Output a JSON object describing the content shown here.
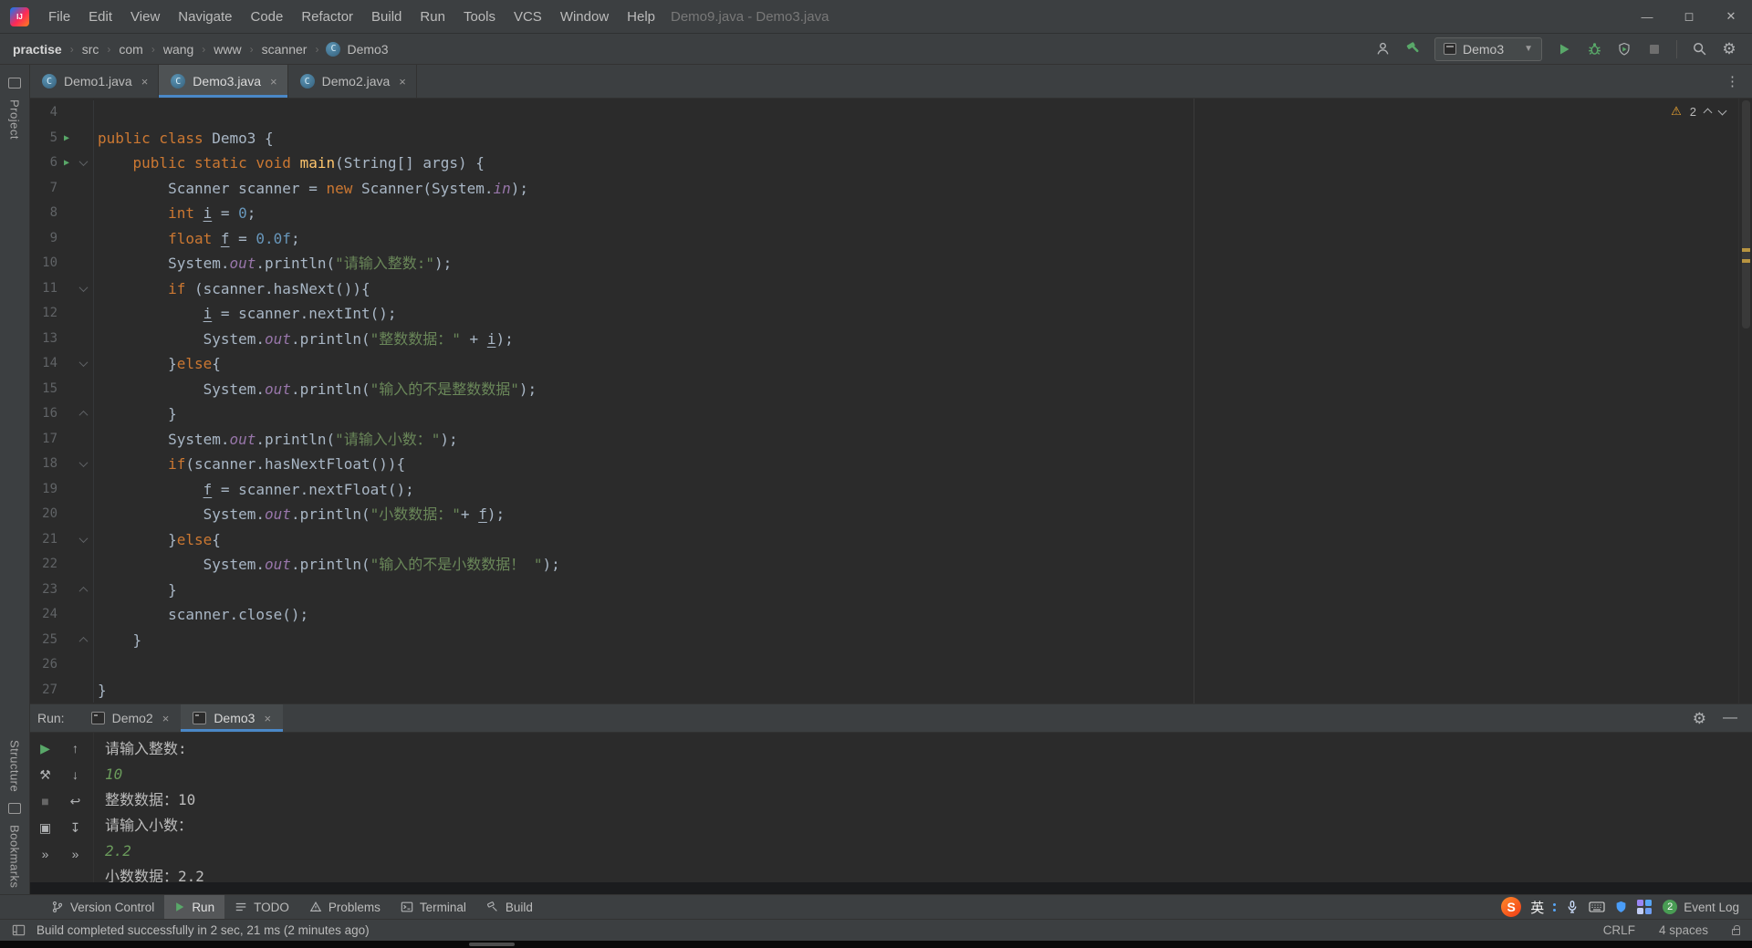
{
  "title_bar": {
    "logo": "IJ",
    "menus": [
      "File",
      "Edit",
      "View",
      "Navigate",
      "Code",
      "Refactor",
      "Build",
      "Run",
      "Tools",
      "VCS",
      "Window",
      "Help"
    ],
    "window_title": "Demo9.java - Demo3.java"
  },
  "nav_bar": {
    "breadcrumb": [
      "practise",
      "src",
      "com",
      "wang",
      "www",
      "scanner",
      "Demo3"
    ],
    "run_config": "Demo3"
  },
  "editor_tabs": [
    {
      "label": "Demo1.java",
      "active": false
    },
    {
      "label": "Demo3.java",
      "active": true
    },
    {
      "label": "Demo2.java",
      "active": false
    }
  ],
  "left_stripe": {
    "top": "Project",
    "bottom": [
      "Structure",
      "Bookmarks"
    ]
  },
  "inspection": {
    "warning_count": "2"
  },
  "editor": {
    "lines": [
      {
        "n": "4",
        "segs": []
      },
      {
        "n": "5",
        "run": true,
        "segs": [
          [
            "k",
            "public class "
          ],
          [
            "p",
            "Demo3 {"
          ]
        ]
      },
      {
        "n": "6",
        "run": true,
        "fold": "down",
        "segs": [
          [
            "p",
            "    "
          ],
          [
            "k",
            "public static void "
          ],
          [
            "m",
            "main"
          ],
          [
            "p",
            "(String[] args) {"
          ]
        ]
      },
      {
        "n": "7",
        "segs": [
          [
            "p",
            "        Scanner scanner = "
          ],
          [
            "k",
            "new "
          ],
          [
            "p",
            "Scanner(System."
          ],
          [
            "f",
            "in"
          ],
          [
            "p",
            ");"
          ]
        ]
      },
      {
        "n": "8",
        "segs": [
          [
            "p",
            "        "
          ],
          [
            "k",
            "int "
          ],
          [
            "u",
            "i"
          ],
          [
            "p",
            " = "
          ],
          [
            "n2",
            "0"
          ],
          [
            "p",
            ";"
          ]
        ]
      },
      {
        "n": "9",
        "segs": [
          [
            "p",
            "        "
          ],
          [
            "k",
            "float "
          ],
          [
            "u",
            "f"
          ],
          [
            "p",
            " = "
          ],
          [
            "n2",
            "0.0f"
          ],
          [
            "p",
            ";"
          ]
        ]
      },
      {
        "n": "10",
        "segs": [
          [
            "p",
            "        System."
          ],
          [
            "f",
            "out"
          ],
          [
            "p",
            ".println("
          ],
          [
            "s",
            "\"请输入整数:\""
          ],
          [
            "p",
            ");"
          ]
        ]
      },
      {
        "n": "11",
        "fold": "down",
        "segs": [
          [
            "p",
            "        "
          ],
          [
            "k",
            "if "
          ],
          [
            "p",
            "(scanner.hasNext()){"
          ]
        ]
      },
      {
        "n": "12",
        "segs": [
          [
            "p",
            "            "
          ],
          [
            "u",
            "i"
          ],
          [
            "p",
            " = scanner.nextInt();"
          ]
        ]
      },
      {
        "n": "13",
        "segs": [
          [
            "p",
            "            System."
          ],
          [
            "f",
            "out"
          ],
          [
            "p",
            ".println("
          ],
          [
            "s",
            "\"整数数据：\""
          ],
          [
            "p",
            " + "
          ],
          [
            "u",
            "i"
          ],
          [
            "p",
            ");"
          ]
        ]
      },
      {
        "n": "14",
        "fold": "down",
        "segs": [
          [
            "p",
            "        }"
          ],
          [
            "k",
            "else"
          ],
          [
            "p",
            "{"
          ]
        ]
      },
      {
        "n": "15",
        "segs": [
          [
            "p",
            "            System."
          ],
          [
            "f",
            "out"
          ],
          [
            "p",
            ".println("
          ],
          [
            "s",
            "\"输入的不是整数数据\""
          ],
          [
            "p",
            ");"
          ]
        ]
      },
      {
        "n": "16",
        "fold": "up",
        "segs": [
          [
            "p",
            "        }"
          ]
        ]
      },
      {
        "n": "17",
        "segs": [
          [
            "p",
            "        System."
          ],
          [
            "f",
            "out"
          ],
          [
            "p",
            ".println("
          ],
          [
            "s",
            "\"请输入小数：\""
          ],
          [
            "p",
            ");"
          ]
        ]
      },
      {
        "n": "18",
        "fold": "down",
        "segs": [
          [
            "p",
            "        "
          ],
          [
            "k",
            "if"
          ],
          [
            "p",
            "(scanner.hasNextFloat()){"
          ]
        ]
      },
      {
        "n": "19",
        "segs": [
          [
            "p",
            "            "
          ],
          [
            "u",
            "f"
          ],
          [
            "p",
            " = scanner.nextFloat();"
          ]
        ]
      },
      {
        "n": "20",
        "segs": [
          [
            "p",
            "            System."
          ],
          [
            "f",
            "out"
          ],
          [
            "p",
            ".println("
          ],
          [
            "s",
            "\"小数数据：\""
          ],
          [
            "p",
            "+ "
          ],
          [
            "u",
            "f"
          ],
          [
            "p",
            ");"
          ]
        ]
      },
      {
        "n": "21",
        "fold": "down",
        "segs": [
          [
            "p",
            "        }"
          ],
          [
            "k",
            "else"
          ],
          [
            "p",
            "{"
          ]
        ]
      },
      {
        "n": "22",
        "segs": [
          [
            "p",
            "            System."
          ],
          [
            "f",
            "out"
          ],
          [
            "p",
            ".println("
          ],
          [
            "s",
            "\"输入的不是小数数据！ \""
          ],
          [
            "p",
            ");"
          ]
        ]
      },
      {
        "n": "23",
        "fold": "up",
        "segs": [
          [
            "p",
            "        }"
          ]
        ]
      },
      {
        "n": "24",
        "segs": [
          [
            "p",
            "        scanner.close();"
          ]
        ]
      },
      {
        "n": "25",
        "fold": "up",
        "segs": [
          [
            "p",
            "    }"
          ]
        ]
      },
      {
        "n": "26",
        "segs": []
      },
      {
        "n": "27",
        "segs": [
          [
            "p",
            "}"
          ]
        ]
      }
    ]
  },
  "run_panel": {
    "label": "Run:",
    "tabs": [
      {
        "label": "Demo2",
        "active": false
      },
      {
        "label": "Demo3",
        "active": true
      }
    ],
    "console_lines": [
      {
        "text": "请输入整数:",
        "type": "stdout"
      },
      {
        "text": "10",
        "type": "stdin"
      },
      {
        "text": "整数数据：10",
        "type": "stdout"
      },
      {
        "text": "请输入小数：",
        "type": "stdout"
      },
      {
        "text": "2.2",
        "type": "stdin"
      },
      {
        "text": "小数数据：2.2",
        "type": "stdout"
      }
    ]
  },
  "bottom_bar": {
    "buttons": [
      {
        "id": "version-control",
        "label": "Version Control",
        "active": false
      },
      {
        "id": "run",
        "label": "Run",
        "active": true
      },
      {
        "id": "todo",
        "label": "TODO",
        "active": false
      },
      {
        "id": "problems",
        "label": "Problems",
        "active": false
      },
      {
        "id": "terminal",
        "label": "Terminal",
        "active": false
      },
      {
        "id": "build",
        "label": "Build",
        "active": false
      }
    ],
    "event_log": {
      "badge": "2",
      "label": "Event Log"
    }
  },
  "ime": {
    "logo": "S",
    "lang": "英"
  },
  "status_bar": {
    "message": "Build completed successfully in 2 sec, 21 ms (2 minutes ago)",
    "line_ending": "CRLF",
    "indent": "4 spaces"
  }
}
